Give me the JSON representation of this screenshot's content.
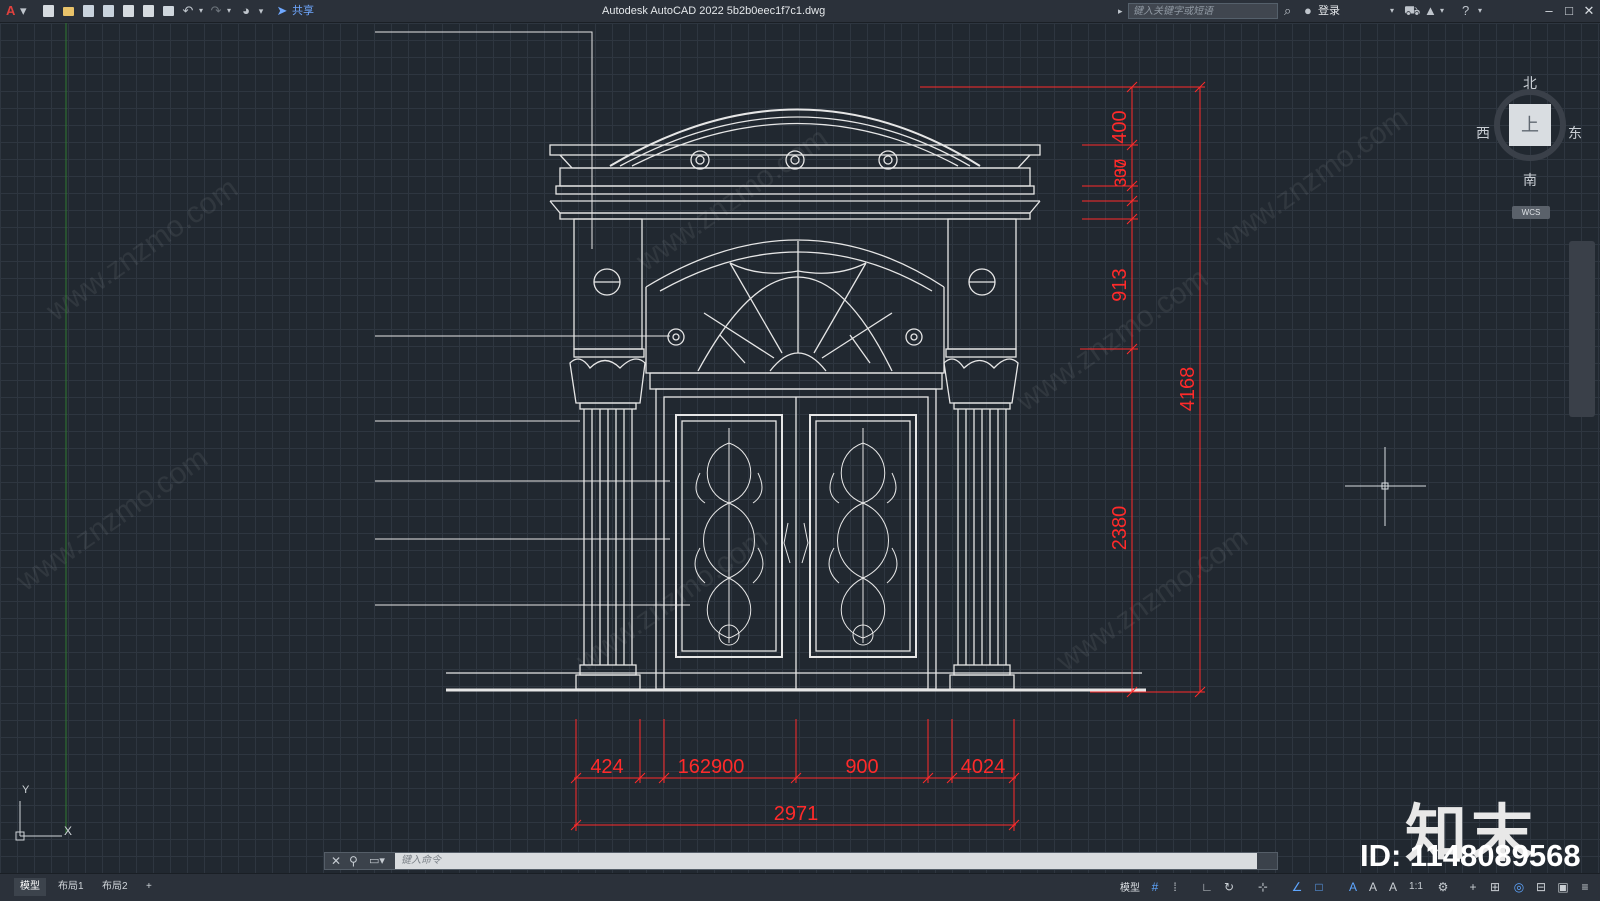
{
  "app": {
    "logo": "A",
    "window_title": "Autodesk AutoCAD 2022    5b2b0eec1f7c1.dwg",
    "share_label": "共享",
    "search_placeholder": "键入关键字或短语",
    "login_label": "登录"
  },
  "viewcube": {
    "north": "北",
    "south": "南",
    "east": "东",
    "west": "西",
    "face": "上",
    "wcs": "WCS"
  },
  "command_line": {
    "placeholder": "键入命令"
  },
  "layout_tabs": [
    {
      "label": "模型",
      "active": true
    },
    {
      "label": "布局1",
      "active": false
    },
    {
      "label": "布局2",
      "active": false
    },
    {
      "label": "+",
      "active": false
    }
  ],
  "status": {
    "model_label": "模型",
    "scale": "1:1"
  },
  "watermark": {
    "text": "www.znzmo.com",
    "brand": "知末",
    "id_label": "ID: 1148089568"
  },
  "drawing": {
    "vertical_dimensions": [
      "400",
      "337",
      "300",
      "913",
      "2380",
      "4168"
    ],
    "horizontal_dimensions": [
      "424",
      "162900",
      "900",
      "4024",
      "2971"
    ],
    "colors": {
      "dimension": "#ff2a2a",
      "linework": "#e6e6e6",
      "grid": "#2e3640"
    }
  }
}
